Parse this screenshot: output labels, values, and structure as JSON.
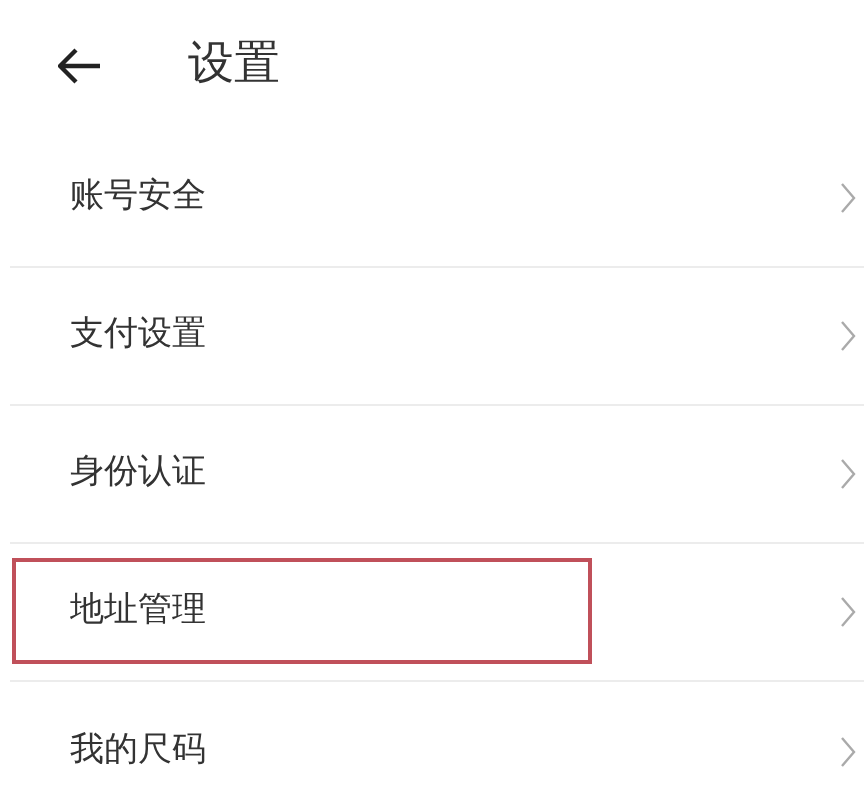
{
  "header": {
    "title": "设置"
  },
  "items": [
    {
      "label": "账号安全",
      "highlighted": false
    },
    {
      "label": "支付设置",
      "highlighted": false
    },
    {
      "label": "身份认证",
      "highlighted": false
    },
    {
      "label": "地址管理",
      "highlighted": true
    },
    {
      "label": "我的尺码",
      "highlighted": false
    }
  ]
}
